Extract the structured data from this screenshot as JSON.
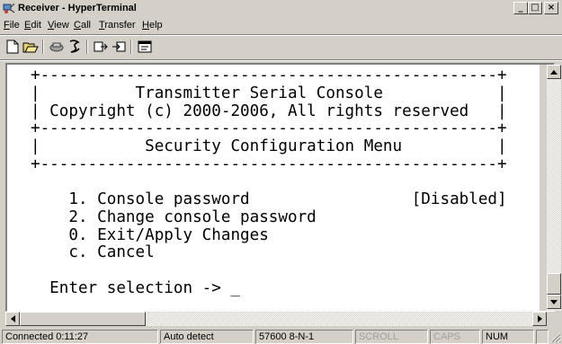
{
  "window": {
    "title": "Receiver - HyperTerminal",
    "min_glyph": "_",
    "max_glyph": "□",
    "close_glyph": "×"
  },
  "menu": {
    "file": {
      "first": "F",
      "rest": "ile"
    },
    "edit": {
      "first": "E",
      "rest": "dit"
    },
    "view": {
      "first": "V",
      "rest": "iew"
    },
    "call": {
      "first": "C",
      "rest": "all"
    },
    "transfer": {
      "first": "T",
      "rest": "ransfer"
    },
    "help": {
      "first": "H",
      "rest": "elp"
    }
  },
  "toolbar": {
    "icons": [
      "new-icon",
      "open-icon",
      "disconnect-icon",
      "call-icon",
      "send-icon",
      "receive-icon",
      "properties-icon"
    ]
  },
  "terminal": {
    "lines": [
      "+------------------------------------------------+",
      "|          Transmitter Serial Console            |",
      "| Copyright (c) 2000-2006, All rights reserved   |",
      "+------------------------------------------------+",
      "|           Security Configuration Menu          |",
      "+------------------------------------------------+",
      "",
      "    1. Console password                 [Disabled]",
      "    2. Change console password",
      "    0. Exit/Apply Changes",
      "    c. Cancel",
      "",
      "  Enter selection -> _"
    ]
  },
  "status": {
    "connected": "Connected 0:11:27",
    "detect": "Auto detect",
    "settings": "57600 8-N-1",
    "scroll": "SCROLL",
    "caps": "CAPS",
    "num": "NUM"
  },
  "colors": {
    "chrome": "#d4d0c8",
    "terminal_bg": "#ffffff",
    "terminal_fg": "#000000",
    "disabled_text": "#a0a0a0"
  }
}
